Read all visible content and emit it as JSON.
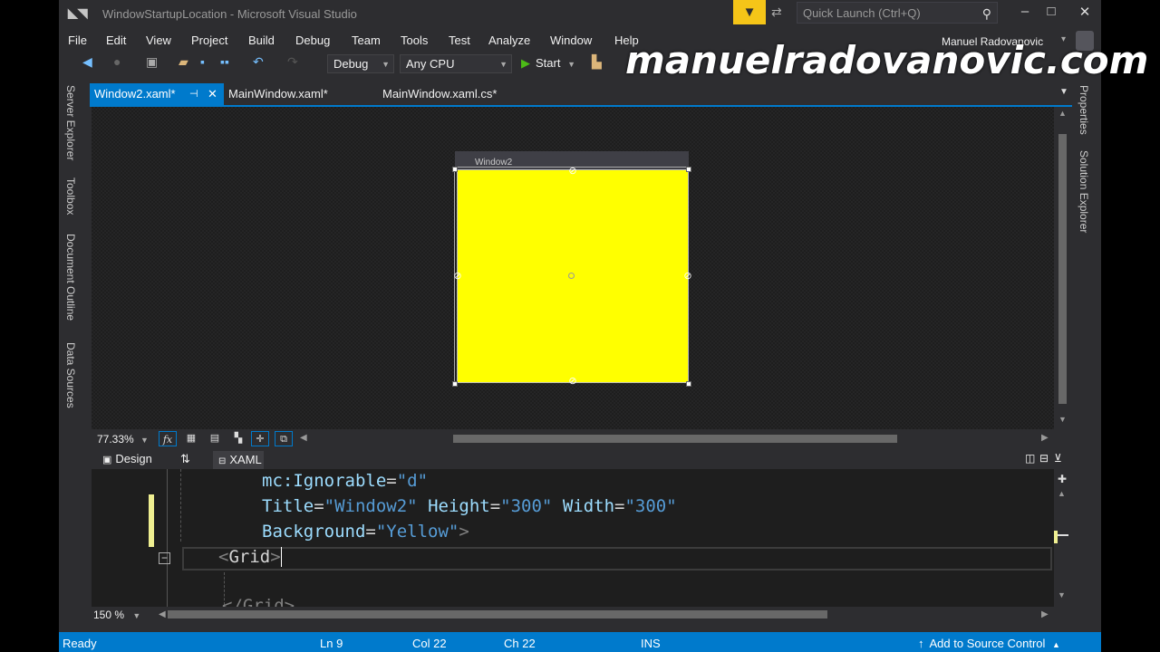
{
  "window": {
    "title": "WindowStartupLocation - Microsoft Visual Studio"
  },
  "quick_launch": {
    "placeholder": "Quick Launch (Ctrl+Q)"
  },
  "window_buttons": {
    "minimize": "–",
    "maximize": "□",
    "close": "✕"
  },
  "menu": [
    "File",
    "Edit",
    "View",
    "Project",
    "Build",
    "Debug",
    "Team",
    "Tools",
    "Test",
    "Analyze",
    "Window",
    "Help"
  ],
  "user": {
    "name": "Manuel Radovanovic"
  },
  "toolbar": {
    "config": "Debug",
    "platform": "Any CPU",
    "start": "Start"
  },
  "watermark": "manuelradovanovic.com",
  "left_rail": [
    "Server Explorer",
    "Toolbox",
    "Document Outline",
    "Data Sources"
  ],
  "right_rail": [
    "Properties",
    "Solution Explorer"
  ],
  "tabs": [
    {
      "label": "Window2.xaml*",
      "active": true
    },
    {
      "label": "MainWindow.xaml*",
      "active": false
    },
    {
      "label": "MainWindow.xaml.cs*",
      "active": false
    }
  ],
  "designer": {
    "window_title": "Window2",
    "window_background": "#FFFF00",
    "zoom": "77.33%",
    "fx": "fx"
  },
  "split": {
    "design": "Design",
    "swap": "⇅",
    "xaml": "XAML"
  },
  "code": {
    "line1": {
      "attr": "mc:Ignorable",
      "eq": "=",
      "val": "\"d\""
    },
    "line2": {
      "a1": "Title",
      "v1": "\"Window2\"",
      "a2": "Height",
      "v2": "\"300\"",
      "a3": "Width",
      "v3": "\"300\"",
      "eq": "="
    },
    "line3": {
      "attr": "Background",
      "eq": "=",
      "val": "\"Yellow\"",
      "close": ">"
    },
    "line4": {
      "open": "<",
      "tag": "Grid",
      "close": ">"
    },
    "line5": {
      "text": "</Grid>"
    }
  },
  "editor": {
    "zoom": "150 %"
  },
  "status": {
    "ready": "Ready",
    "ln": "Ln 9",
    "col": "Col 22",
    "ch": "Ch 22",
    "ins": "INS",
    "source_control": "Add to Source Control"
  }
}
